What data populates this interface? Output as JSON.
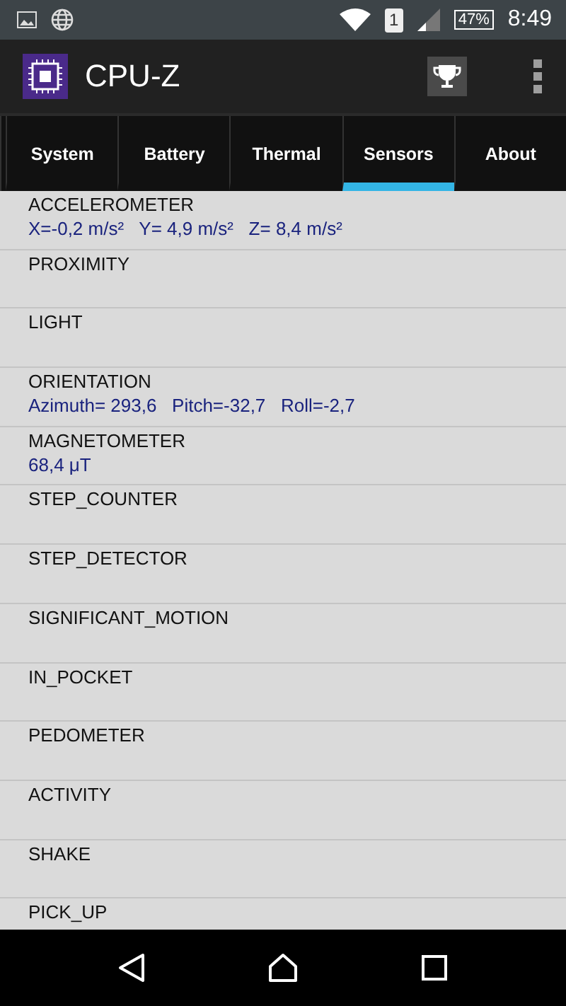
{
  "status_bar": {
    "sim": "1",
    "battery": "47%",
    "time": "8:49"
  },
  "app_bar": {
    "title": "CPU-Z"
  },
  "tabs": [
    {
      "label": "System",
      "selected": false
    },
    {
      "label": "Battery",
      "selected": false
    },
    {
      "label": "Thermal",
      "selected": false
    },
    {
      "label": "Sensors",
      "selected": true
    },
    {
      "label": "About",
      "selected": false
    }
  ],
  "sensors": [
    {
      "name": "ACCELEROMETER",
      "value": "X=-0,2 m/s²   Y= 4,9 m/s²   Z= 8,4 m/s²"
    },
    {
      "name": "PROXIMITY"
    },
    {
      "name": "LIGHT"
    },
    {
      "name": "ORIENTATION",
      "value": "Azimuth= 293,6   Pitch=-32,7   Roll=-2,7"
    },
    {
      "name": "MAGNETOMETER",
      "value": "68,4 μT"
    },
    {
      "name": "STEP_COUNTER"
    },
    {
      "name": "STEP_DETECTOR"
    },
    {
      "name": "SIGNIFICANT_MOTION"
    },
    {
      "name": "IN_POCKET"
    },
    {
      "name": "PEDOMETER"
    },
    {
      "name": "ACTIVITY"
    },
    {
      "name": "SHAKE"
    },
    {
      "name": "PICK_UP"
    }
  ]
}
